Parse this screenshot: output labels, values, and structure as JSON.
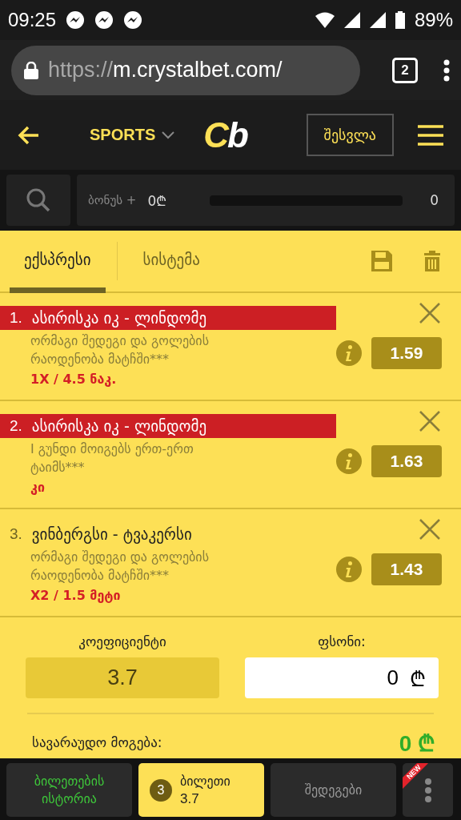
{
  "status_bar": {
    "time": "09:25",
    "battery": "89%"
  },
  "browser": {
    "url": {
      "scheme": "https://",
      "host": "m.crystalbet.com/"
    },
    "tab_count": "2"
  },
  "header": {
    "sports_label": "SPORTS",
    "logo": "Cb",
    "login": "შესვლა"
  },
  "bonus": {
    "label": "ბონუს +",
    "amount": "0₾",
    "level": 0,
    "count": "0"
  },
  "tabs": [
    {
      "label": "ექსპრესი",
      "selected": true
    },
    {
      "label": "სისტემა",
      "selected": false
    }
  ],
  "bets": [
    {
      "number": "1.",
      "teams": "ასირისკა იკ - ლინდომე",
      "market": "ორმაგი შედეგი და გოლების რაოდენობა მატჩში***",
      "pick": "1X / 4.5 ნაკ.",
      "odds": "1.59",
      "highlighted": true
    },
    {
      "number": "2.",
      "teams": "ასირისკა იკ - ლინდომე",
      "market": "I გუნდი მოიგებს ერთ-ერთ ტაიმს***",
      "pick": "კი",
      "odds": "1.63",
      "highlighted": true
    },
    {
      "number": "3.",
      "teams": "ვინბერგსი - ტვაკერსი",
      "market": "ორმაგი შედეგი და გოლების რაოდენობა მატჩში***",
      "pick": "X2 / 1.5 მეტი",
      "odds": "1.43",
      "highlighted": false
    }
  ],
  "summary": {
    "odds_label": "კოეფიციენტი",
    "odds_value": "3.7",
    "stake_label": "ფსონი:",
    "stake_value": "0",
    "currency": "₾",
    "win_label": "სავარაუდო მოგება:",
    "win_value": "0 ₾"
  },
  "bottom_nav": [
    {
      "kind": "history",
      "label": "ბილეთების ისტორია",
      "selected": false
    },
    {
      "kind": "slip",
      "count": "3",
      "label": "ბილეთი",
      "value": "3.7",
      "selected": true
    },
    {
      "kind": "results",
      "label": "შედეგები",
      "selected": false
    },
    {
      "kind": "more",
      "badge": "NEW",
      "selected": false
    }
  ]
}
